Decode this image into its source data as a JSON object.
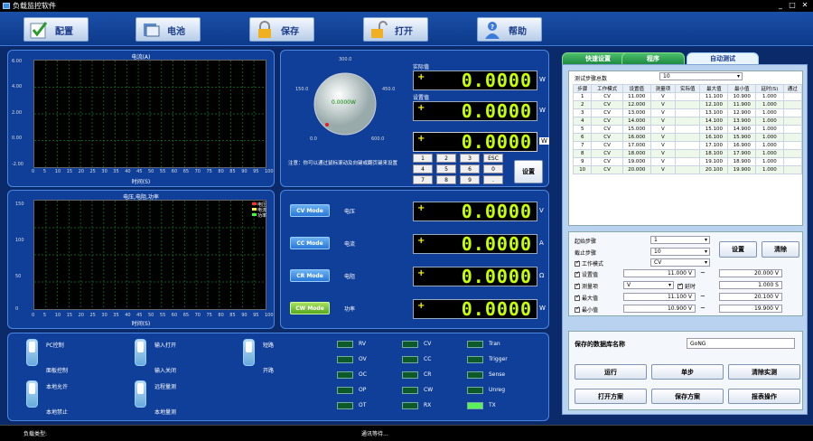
{
  "window": {
    "title": "负载监控软件",
    "min": "_",
    "max": "□",
    "close": "✕"
  },
  "toolbar": [
    {
      "label": "配置",
      "icon": "check-icon"
    },
    {
      "label": "电池",
      "icon": "battery-icon"
    },
    {
      "label": "保存",
      "icon": "lock-icon"
    },
    {
      "label": "打开",
      "icon": "unlock-icon"
    },
    {
      "label": "帮助",
      "icon": "help-person-icon"
    }
  ],
  "chart1": {
    "title": "电流(A)",
    "xlabel": "时间(S)",
    "yticks": [
      "6.00",
      "4.00",
      "2.00",
      "0.00",
      "-2.00"
    ],
    "xticks": [
      "0",
      "5",
      "10",
      "15",
      "20",
      "25",
      "30",
      "35",
      "40",
      "45",
      "50",
      "55",
      "60",
      "65",
      "70",
      "75",
      "80",
      "85",
      "90",
      "95",
      "100"
    ]
  },
  "chart2": {
    "title": "电压,电阻,功率",
    "xlabel": "时间(S)",
    "yticks": [
      "150",
      "100",
      "50",
      "0"
    ],
    "xticks": [
      "0",
      "5",
      "10",
      "15",
      "20",
      "25",
      "30",
      "35",
      "40",
      "45",
      "50",
      "55",
      "60",
      "65",
      "70",
      "75",
      "80",
      "85",
      "90",
      "95",
      "100"
    ],
    "legend": [
      {
        "name": "电压",
        "color": "#ff3030"
      },
      {
        "name": "电流",
        "color": "#ffff40"
      },
      {
        "name": "功率",
        "color": "#40ff40"
      }
    ]
  },
  "dial": {
    "value": "0.0000W",
    "ticks": [
      "300.0",
      "150.0",
      "450.0",
      "0.0",
      "600.0"
    ],
    "note": "注意：你可以通过鼠标滚动及向键或翻页键来设置"
  },
  "power_displays": {
    "actual_label": "实际值",
    "set_label": "设置值",
    "actual": "0.0000",
    "setval": "0.0000",
    "entry": "0.0000",
    "unit": "W"
  },
  "keypad": {
    "keys": [
      "1",
      "2",
      "3",
      "ESC",
      "4",
      "5",
      "6",
      "0",
      "7",
      "8",
      "9",
      "."
    ],
    "set_button": "设置"
  },
  "modes": [
    {
      "button": "CV Mode",
      "label": "电压",
      "value": "0.0000",
      "unit": "V",
      "active": false
    },
    {
      "button": "CC Mode",
      "label": "电流",
      "value": "0.0000",
      "unit": "A",
      "active": false
    },
    {
      "button": "CR Mode",
      "label": "电阻",
      "value": "0.0000",
      "unit": "Ω",
      "active": false
    },
    {
      "button": "CW Mode",
      "label": "功率",
      "value": "0.0000",
      "unit": "W",
      "active": true
    }
  ],
  "switches": [
    {
      "top": "PC控制",
      "bottom": "面板控制"
    },
    {
      "top": "输入打开",
      "bottom": "输入关闭"
    },
    {
      "top": "短路",
      "bottom": "开路"
    },
    {
      "top": "本地允许",
      "bottom": "本地禁止"
    },
    {
      "top": "远程量测",
      "bottom": "本地量测"
    }
  ],
  "leds": [
    {
      "label": "RV",
      "on": false
    },
    {
      "label": "CV",
      "on": false
    },
    {
      "label": "Tran",
      "on": false
    },
    {
      "label": "OV",
      "on": false
    },
    {
      "label": "CC",
      "on": false
    },
    {
      "label": "Trigger",
      "on": false
    },
    {
      "label": "OC",
      "on": false
    },
    {
      "label": "CR",
      "on": false
    },
    {
      "label": "Sense",
      "on": false
    },
    {
      "label": "OP",
      "on": false
    },
    {
      "label": "CW",
      "on": false
    },
    {
      "label": "Unreg",
      "on": false
    },
    {
      "label": "OT",
      "on": false
    },
    {
      "label": "RX",
      "on": false
    },
    {
      "label": "TX",
      "on": true
    }
  ],
  "tabs": [
    "快速设置",
    "程序",
    "自动测试"
  ],
  "auto_test": {
    "steps_total_label": "测试步骤总数",
    "steps_total": "10",
    "columns": [
      "步骤",
      "工作模式",
      "设置值",
      "测量项",
      "实际值",
      "最大值",
      "最小值",
      "延时(S)",
      "通过"
    ],
    "rows": [
      [
        "1",
        "CV",
        "11.000",
        "V",
        "",
        "11.100",
        "10.900",
        "1.000",
        ""
      ],
      [
        "2",
        "CV",
        "12.000",
        "V",
        "",
        "12.100",
        "11.900",
        "1.000",
        ""
      ],
      [
        "3",
        "CV",
        "13.000",
        "V",
        "",
        "13.100",
        "12.900",
        "1.000",
        ""
      ],
      [
        "4",
        "CV",
        "14.000",
        "V",
        "",
        "14.100",
        "13.900",
        "1.000",
        ""
      ],
      [
        "5",
        "CV",
        "15.000",
        "V",
        "",
        "15.100",
        "14.900",
        "1.000",
        ""
      ],
      [
        "6",
        "CV",
        "16.000",
        "V",
        "",
        "16.100",
        "15.900",
        "1.000",
        ""
      ],
      [
        "7",
        "CV",
        "17.000",
        "V",
        "",
        "17.100",
        "16.900",
        "1.000",
        ""
      ],
      [
        "8",
        "CV",
        "18.000",
        "V",
        "",
        "18.100",
        "17.900",
        "1.000",
        ""
      ],
      [
        "9",
        "CV",
        "19.000",
        "V",
        "",
        "19.100",
        "18.900",
        "1.000",
        ""
      ],
      [
        "10",
        "CV",
        "20.000",
        "V",
        "",
        "20.100",
        "19.900",
        "1.000",
        ""
      ]
    ],
    "start_step_label": "起始步骤",
    "start_step": "1",
    "end_step_label": "截止步骤",
    "end_step": "10",
    "mode_label": "工作模式",
    "mode": "CV",
    "setval_label": "设置值",
    "setval_from": "11.000 V",
    "setval_to": "20.000 V",
    "measure_label": "测量项",
    "measure": "V",
    "delay_label": "延时",
    "delay": "1.000 S",
    "max_label": "最大值",
    "max_from": "11.100 V",
    "max_to": "20.100 V",
    "min_label": "最小值",
    "min_from": "10.900 V",
    "min_to": "19.900 V",
    "tilde": "~",
    "set_button": "设置",
    "clear_button": "清除",
    "db_label": "保存的数据库名称",
    "db_name": "GoNG",
    "buttons": [
      "运行",
      "单步",
      "清除实测",
      "打开方案",
      "保存方案",
      "报表操作"
    ]
  },
  "status": {
    "load_type": "负载类型:",
    "comm": "通讯等待..."
  }
}
